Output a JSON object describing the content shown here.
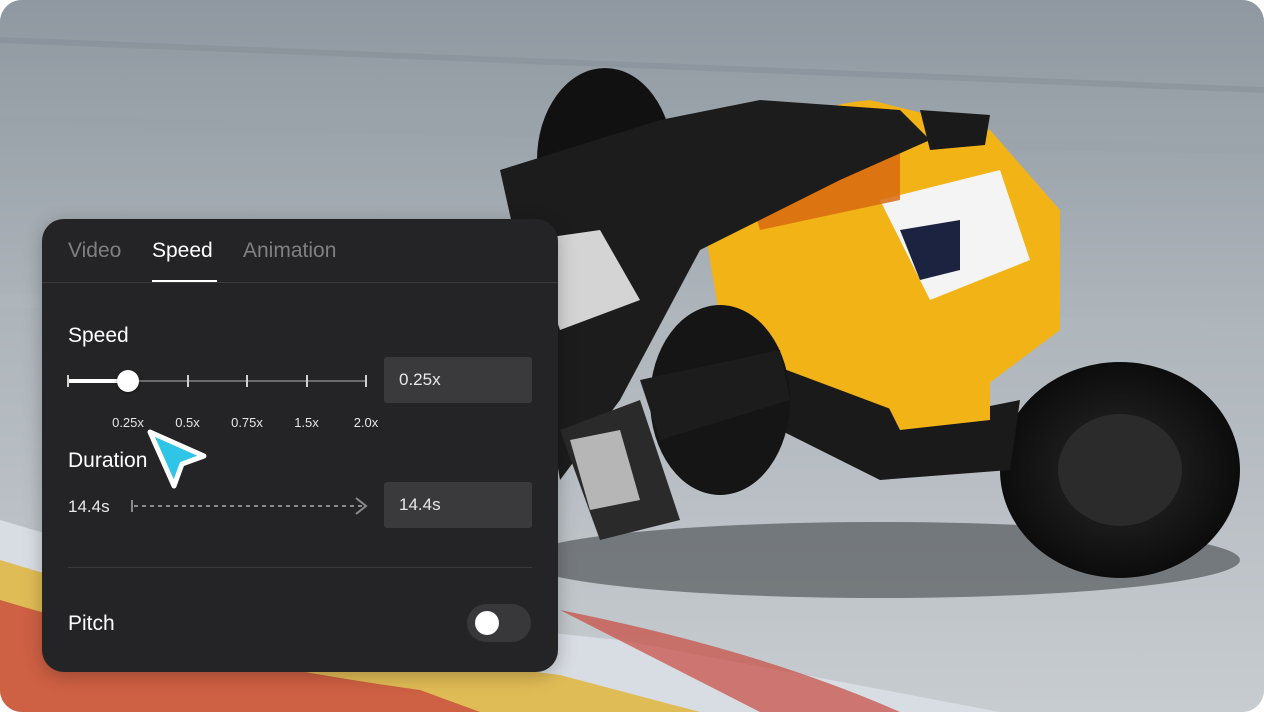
{
  "tabs": [
    {
      "label": "Video",
      "active": false
    },
    {
      "label": "Speed",
      "active": true
    },
    {
      "label": "Animation",
      "active": false
    }
  ],
  "speed": {
    "title": "Speed",
    "value": "0.25x",
    "options": [
      "0.25x",
      "0.5x",
      "0.75x",
      "1.5x",
      "2.0x"
    ],
    "selected_index": 0
  },
  "duration": {
    "title": "Duration",
    "original": "14.4s",
    "result": "14.4s"
  },
  "pitch": {
    "title": "Pitch",
    "enabled": false
  },
  "icons": {
    "cursor": "pointer-cursor-icon",
    "arrow": "dashed-arrow-right-icon"
  },
  "colors": {
    "panel_bg": "#242426",
    "field_bg": "#3a3a3d",
    "cursor_fill": "#2ec5e6",
    "bike_yellow": "#f2b316"
  }
}
